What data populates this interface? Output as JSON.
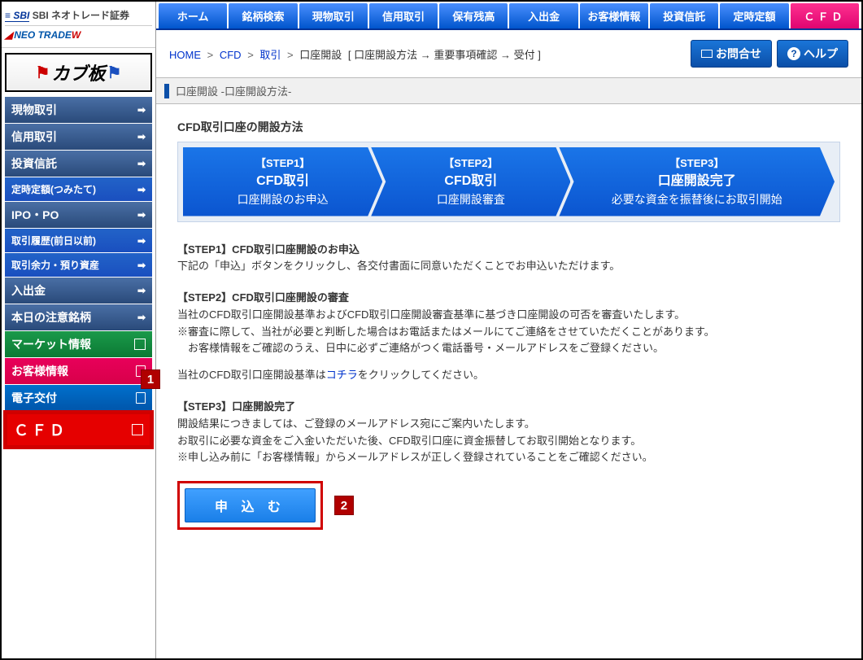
{
  "logo": {
    "company": "SBI ネオトレード証券",
    "subbrand_pre": "NEO TRADE",
    "subbrand_w": "W"
  },
  "kabu": {
    "text": "カブ板"
  },
  "sidebar": {
    "items": [
      {
        "label": "現物取引",
        "cls": "blue-dark",
        "right": "arrow"
      },
      {
        "label": "信用取引",
        "cls": "blue-dark",
        "right": "arrow"
      },
      {
        "label": "投資信託",
        "cls": "blue-dark",
        "right": "arrow"
      },
      {
        "label": "定時定額(つみたて)",
        "cls": "blue",
        "right": "arrow"
      },
      {
        "label": "IPO・PO",
        "cls": "blue-dark",
        "right": "arrow"
      },
      {
        "label": "取引履歴(前日以前)",
        "cls": "blue",
        "right": "arrow"
      },
      {
        "label": "取引余力・預り資産",
        "cls": "blue",
        "right": "arrow"
      },
      {
        "label": "入出金",
        "cls": "blue-dark",
        "right": "arrow"
      },
      {
        "label": "本日の注意銘柄",
        "cls": "blue-dark",
        "right": "arrow"
      },
      {
        "label": "マーケット情報",
        "cls": "green",
        "right": "square"
      },
      {
        "label": "お客様情報",
        "cls": "pink",
        "right": "doc"
      },
      {
        "label": "電子交付",
        "cls": "blue-mid",
        "right": "doc"
      },
      {
        "label": "ＣＦＤ",
        "cls": "red cfd-highlight",
        "right": "square"
      }
    ]
  },
  "tabs": [
    "ホーム",
    "銘柄検索",
    "現物取引",
    "信用取引",
    "保有残高",
    "入出金",
    "お客様情報",
    "投資信託",
    "定時定額",
    "ＣＦＤ"
  ],
  "breadcrumb": {
    "home": "HOME",
    "cfd": "CFD",
    "torihiki": "取引",
    "kouza": "口座開設",
    "steps_bracket": "[ 口座開設方法 → 重要事項確認 → 受付 ]"
  },
  "help": {
    "contact": "お問合せ",
    "help": "ヘルプ"
  },
  "section_title": "口座開設 -口座開設方法-",
  "main_heading": "CFD取引口座の開設方法",
  "flow": {
    "s1": {
      "label": "【STEP1】",
      "title": "CFD取引",
      "sub": "口座開設のお申込"
    },
    "s2": {
      "label": "【STEP2】",
      "title": "CFD取引",
      "sub": "口座開設審査"
    },
    "s3": {
      "label": "【STEP3】",
      "title": "口座開設完了",
      "sub": "必要な資金を振替後にお取引開始"
    }
  },
  "details": {
    "s1": {
      "h": "【STEP1】CFD取引口座開設のお申込",
      "p1": "下記の「申込」ボタンをクリックし、各交付書面に同意いただくことでお申込いただけます。"
    },
    "s2": {
      "h": "【STEP2】CFD取引口座開設の審査",
      "p1": "当社のCFD取引口座開設基準およびCFD取引口座開設審査基準に基づき口座開設の可否を審査いたします。",
      "p2": "※審査に際して、当社が必要と判断した場合はお電話またはメールにてご連絡をさせていただくことがあります。",
      "p3": "　お客様情報をご確認のうえ、日中に必ずご連絡がつく電話番号・メールアドレスをご登録ください。",
      "p4_pre": "当社のCFD取引口座開設基準は",
      "p4_link": "コチラ",
      "p4_post": "をクリックしてください。"
    },
    "s3": {
      "h": "【STEP3】口座開設完了",
      "p1": "開設結果につきましては、ご登録のメールアドレス宛にご案内いたします。",
      "p2": "お取引に必要な資金をご入金いただいた後、CFD取引口座に資金振替してお取引開始となります。",
      "p3": "※申し込み前に「お客様情報」からメールアドレスが正しく登録されていることをご確認ください。"
    }
  },
  "apply_label": "申 込 む",
  "markers": {
    "m1": "1",
    "m2": "2"
  }
}
